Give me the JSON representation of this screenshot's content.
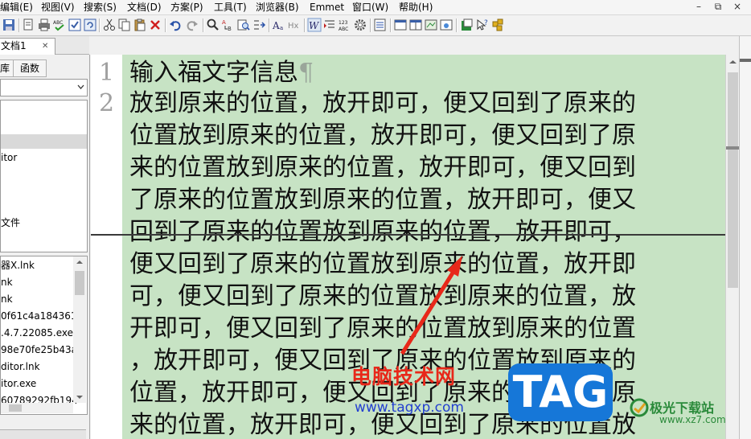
{
  "menubar": {
    "items": [
      "编辑(E)",
      "视图(V)",
      "搜索(S)",
      "文档(D)",
      "方案(P)",
      "工具(T)",
      "浏览器(B)",
      "Emmet",
      "窗口(W)",
      "帮助(H)"
    ],
    "window_controls": [
      "–",
      "⧉",
      "×"
    ]
  },
  "tabs": {
    "document": "文档1",
    "close": "✕"
  },
  "sidebar": {
    "tabs": [
      "库",
      "函数"
    ],
    "tree_items": [
      "itor",
      "文件"
    ],
    "file_items": [
      "器X.lnk",
      "nk",
      "nk",
      "0f61c4a1843616",
      ".4.7.22085.exe",
      "98e70fe25b43a0",
      "ditor.lnk",
      "itor.exe",
      "60789292fb194"
    ]
  },
  "editor": {
    "line_numbers": [
      "1",
      "2"
    ],
    "lines": [
      "输入福文字信息",
      "放到原来的位置，放开即可，便又回到了原来的",
      "位置放到原来的位置，放开即可，便又回到了原",
      "来的位置放到原来的位置，放开即可，便又回到",
      "了原来的位置放到原来的位置，放开即可，便又",
      "回到了原来的位置放到原来的位置，放开即可，",
      "便又回到了原来的位置放到原来的位置，放开即",
      "可，便又回到了原来的位置放到原来的位置，放",
      "开即可，便又回到了原来的位置放到原来的位置",
      "，放开即可，便又回到了原来的位置放到原来的",
      "位置，放开即可，便又回到了原来的位置放到原",
      "来的位置，放开即可，便又回到了原来的位置放"
    ],
    "pilcrow": "¶"
  },
  "watermark": {
    "site_name": "电脑技术网",
    "url": "www.tagxp.com",
    "badge": "TAG",
    "xz_name": "极光下载站",
    "xz_url": "www.xz7.com"
  },
  "colors": {
    "editor_bg": "#c7e3c4",
    "accent_arrow": "#e8281a",
    "badge": "#1677d8"
  }
}
